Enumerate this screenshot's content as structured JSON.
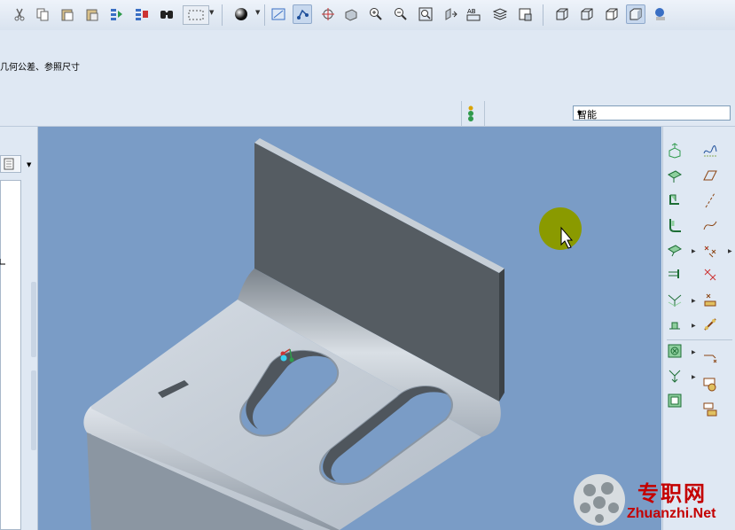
{
  "message_bar": {
    "text": "几何公差、参照尺寸"
  },
  "filter": {
    "selected": "智能"
  },
  "watermark": {
    "brand_cn": "专职网",
    "brand_url": "Zhuanzhi.Net"
  },
  "colors": {
    "viewport_bg": "#7a9cc6",
    "part_top": "#c9d1db",
    "part_wall": "#555c62",
    "highlight_circle": "#8a9a00",
    "toolbar_green": "#2f9a4c"
  },
  "toolbar_icons": [
    "cut-icon",
    "copy-icon",
    "paste-icon",
    "paste-special-icon",
    "regenerate-icon",
    "regenerate-manager-icon",
    "find-icon",
    "select-box-icon",
    "appearance-sphere-icon",
    "datum-plane-toggle-icon",
    "datum-axis-toggle-icon",
    "spin-center-icon",
    "orient-icon",
    "zoom-in-icon",
    "zoom-out-icon",
    "refit-icon",
    "reorient-icon",
    "view-manager-icon",
    "layers-icon",
    "named-views-icon",
    "wireframe-icon",
    "hidden-line-icon",
    "no-hidden-icon",
    "shading-icon",
    "model-tree-icon"
  ],
  "right_toolbar_icons": [
    "extrude-icon",
    "datum-curve-icon",
    "flat-wall-icon",
    "datum-plane-icon",
    "flange-wall-icon",
    "datum-axis-icon",
    "unbend-icon",
    "sketch-icon",
    "bend-back-icon",
    "datum-point-icon",
    "edge-rip-icon",
    "analysis-icon",
    "corner-relief-icon",
    "annotation-icon",
    "form-icon",
    "feature-insert-icon",
    "flatten-icon",
    "extend-icon",
    "merge-icon",
    "pattern-icon"
  ]
}
